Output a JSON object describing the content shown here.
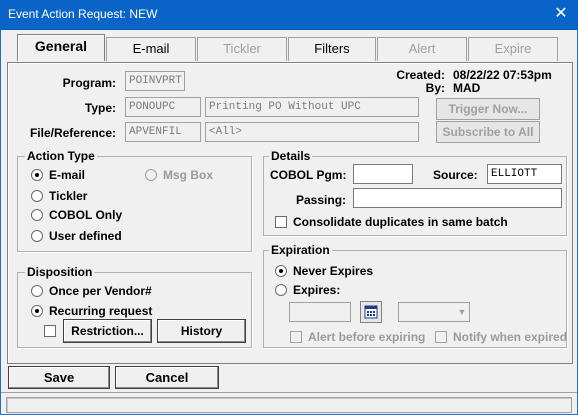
{
  "window": {
    "title": "Event Action Request: NEW",
    "close_glyph": "✕"
  },
  "tabs": [
    "General",
    "E-mail",
    "Tickler",
    "Filters",
    "Alert",
    "Expire"
  ],
  "header": {
    "program_label": "Program:",
    "program_value": "POINVPRT",
    "type_label": "Type:",
    "type_code": "PONOUPC",
    "type_desc": "Printing PO Without UPC",
    "file_label": "File/Reference:",
    "file_value": "APVENFIL",
    "file_ref": "<All>",
    "created_label": "Created:",
    "created_value": "08/22/22 07:53pm",
    "by_label": "By:",
    "by_value": "MAD",
    "trigger_button": "Trigger Now...",
    "subscribe_button": "Subscribe to All"
  },
  "action_type": {
    "title": "Action Type",
    "options": [
      "E-mail",
      "Tickler",
      "COBOL Only",
      "User defined"
    ],
    "msgbox_label": "Msg Box",
    "selected": "E-mail"
  },
  "disposition": {
    "title": "Disposition",
    "options": [
      "Once per Vendor#",
      "Recurring request"
    ],
    "selected": "Recurring request",
    "restriction_button": "Restriction...",
    "history_button": "History"
  },
  "details": {
    "title": "Details",
    "cobol_label": "COBOL Pgm:",
    "cobol_value": "",
    "source_label": "Source:",
    "source_value": "ELLIOTT",
    "passing_label": "Passing:",
    "passing_value": "",
    "consolidate_label": "Consolidate duplicates in same batch"
  },
  "expiration": {
    "title": "Expiration",
    "never_label": "Never Expires",
    "expires_label": "Expires:",
    "selected": "Never Expires",
    "alert_label": "Alert before expiring",
    "notify_label": "Notify when expired"
  },
  "footer": {
    "save_button": "Save",
    "cancel_button": "Cancel"
  },
  "colors": {
    "titlebar": "#0a64c8",
    "background": "#f0f0f0",
    "disabled_text": "#a0a0a0"
  }
}
